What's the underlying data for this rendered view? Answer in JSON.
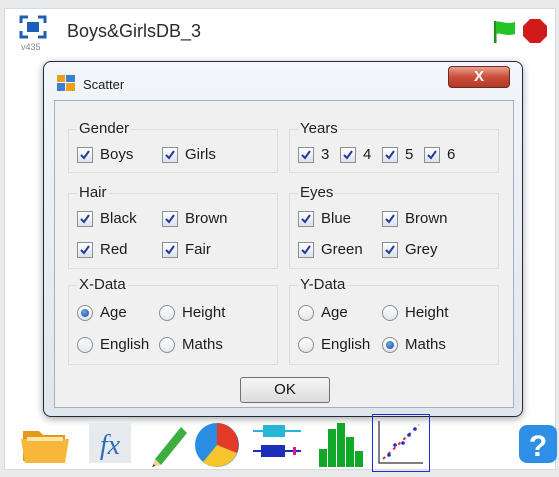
{
  "app": {
    "title": "Boys&GirlsDB_3",
    "version": "v435"
  },
  "dialog": {
    "title": "Scatter",
    "close_label": "X",
    "ok_label": "OK",
    "groups": {
      "gender": {
        "label": "Gender",
        "options": [
          {
            "label": "Boys",
            "checked": true
          },
          {
            "label": "Girls",
            "checked": true
          }
        ]
      },
      "years": {
        "label": "Years",
        "options": [
          {
            "label": "3",
            "checked": true
          },
          {
            "label": "4",
            "checked": true
          },
          {
            "label": "5",
            "checked": true
          },
          {
            "label": "6",
            "checked": true
          }
        ]
      },
      "hair": {
        "label": "Hair",
        "options": [
          {
            "label": "Black",
            "checked": true
          },
          {
            "label": "Brown",
            "checked": true
          },
          {
            "label": "Red",
            "checked": true
          },
          {
            "label": "Fair",
            "checked": true
          }
        ]
      },
      "eyes": {
        "label": "Eyes",
        "options": [
          {
            "label": "Blue",
            "checked": true
          },
          {
            "label": "Brown",
            "checked": true
          },
          {
            "label": "Green",
            "checked": true
          },
          {
            "label": "Grey",
            "checked": true
          }
        ]
      },
      "x_data": {
        "label": "X-Data",
        "selected": "Age",
        "options": [
          "Age",
          "Height",
          "English",
          "Maths"
        ]
      },
      "y_data": {
        "label": "Y-Data",
        "selected": "Maths",
        "options": [
          "Age",
          "Height",
          "English",
          "Maths"
        ]
      }
    }
  },
  "toolbar": {
    "tools": [
      {
        "icon": "folder-icon"
      },
      {
        "icon": "function-icon"
      },
      {
        "icon": "pencil-icon"
      },
      {
        "icon": "pie-chart-icon"
      },
      {
        "icon": "box-plot-icon"
      },
      {
        "icon": "histogram-icon"
      },
      {
        "icon": "scatter-plot-icon",
        "selected": true
      },
      {
        "icon": "help-icon"
      }
    ]
  },
  "colors": {
    "flag": "#22c322",
    "stop": "#d11a1a",
    "close": "#c94d38",
    "selection": "#1c2fd6"
  }
}
